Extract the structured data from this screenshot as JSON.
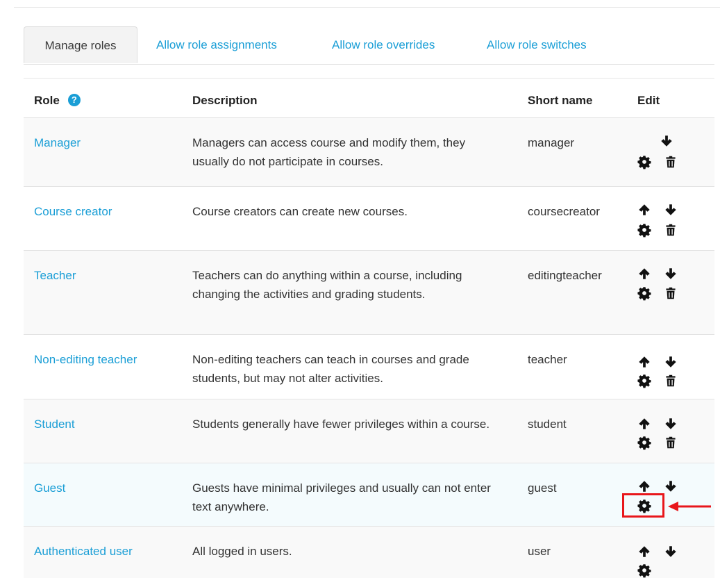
{
  "tabs": [
    {
      "label": "Manage roles",
      "active": true
    },
    {
      "label": "Allow role assignments",
      "active": false
    },
    {
      "label": "Allow role overrides",
      "active": false
    },
    {
      "label": "Allow role switches",
      "active": false
    }
  ],
  "table": {
    "headers": {
      "role": "Role",
      "description": "Description",
      "short_name": "Short name",
      "edit": "Edit"
    },
    "rows": [
      {
        "role": "Manager",
        "description": "Managers can access course and modify them, they usually do not participate in courses.",
        "short_name": "manager",
        "icons": [
          "arrow-down-icon",
          "gear-icon",
          "trash-icon"
        ]
      },
      {
        "role": "Course creator",
        "description": "Course creators can create new courses.",
        "short_name": "coursecreator",
        "icons": [
          "arrow-up-icon",
          "arrow-down-icon",
          "gear-icon",
          "trash-icon"
        ]
      },
      {
        "role": "Teacher",
        "description": "Teachers can do anything within a course, including changing the activities and grading students.",
        "short_name": "editingteacher",
        "icons": [
          "arrow-up-icon",
          "arrow-down-icon",
          "gear-icon",
          "trash-icon"
        ]
      },
      {
        "role": "Non-editing teacher",
        "description": "Non-editing teachers can teach in courses and grade students, but may not alter activities.",
        "short_name": "teacher",
        "icons": [
          "arrow-up-icon",
          "arrow-down-icon",
          "gear-icon",
          "trash-icon"
        ]
      },
      {
        "role": "Student",
        "description": "Students generally have fewer privileges within a course.",
        "short_name": "student",
        "icons": [
          "arrow-up-icon",
          "arrow-down-icon",
          "gear-icon",
          "trash-icon"
        ]
      },
      {
        "role": "Guest",
        "description": "Guests have minimal privileges and usually can not enter text anywhere.",
        "short_name": "guest",
        "icons": [
          "arrow-up-icon",
          "arrow-down-icon",
          "gear-icon"
        ]
      },
      {
        "role": "Authenticated user",
        "description": "All logged in users.",
        "short_name": "user",
        "icons": [
          "arrow-up-icon",
          "arrow-down-icon",
          "gear-icon"
        ]
      }
    ]
  },
  "colors": {
    "link": "#1a9ed6",
    "highlight": "#e8161b"
  }
}
